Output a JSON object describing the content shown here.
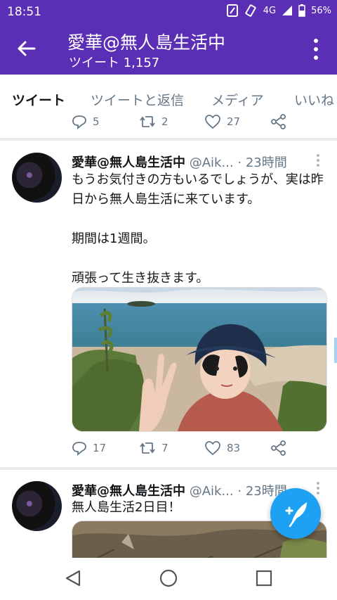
{
  "status": {
    "time": "18:51",
    "network": "4G",
    "battery": "56%"
  },
  "header": {
    "title": "愛華@無人島生活中",
    "subtitle": "ツイート 1,157"
  },
  "tabs": [
    {
      "label": "ツイート",
      "active": true
    },
    {
      "label": "ツイートと返信",
      "active": false
    },
    {
      "label": "メディア",
      "active": false
    },
    {
      "label": "いいね",
      "active": false
    }
  ],
  "top_actions": {
    "replies": "5",
    "retweets": "2",
    "likes": "27"
  },
  "tweets": [
    {
      "name": "愛華@無人島生活中",
      "handle": "@Aik...",
      "time": "· 23時間",
      "lines": [
        "もうお気付きの方もいるでしょうが、実は昨日から無人島生活に来ています。",
        "期間は1週間。",
        "頑張って生き抜きます。"
      ],
      "replies": "17",
      "retweets": "7",
      "likes": "83"
    },
    {
      "name": "愛華@無人島生活中",
      "handle": "@Aik...",
      "time": "· 23時間",
      "lines": [
        "無人島生活2日目！"
      ]
    }
  ],
  "colors": {
    "brand": "#5a2fb5",
    "accent": "#1da1f2",
    "muted": "#657786"
  }
}
